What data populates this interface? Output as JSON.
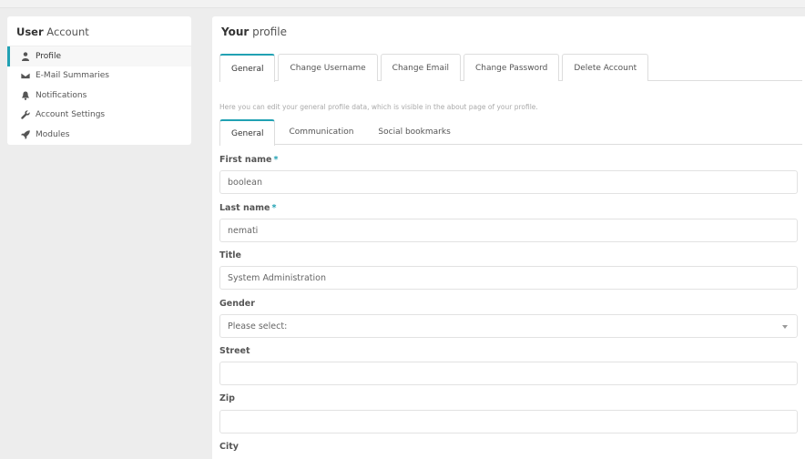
{
  "sidebar": {
    "title_bold": "User",
    "title_rest": " Account",
    "items": [
      {
        "label": "Profile",
        "icon": "user-icon",
        "active": true
      },
      {
        "label": "E-Mail Summaries",
        "icon": "envelope-icon"
      },
      {
        "label": "Notifications",
        "icon": "bell-icon"
      },
      {
        "label": "Account Settings",
        "icon": "wrench-icon"
      },
      {
        "label": "Modules",
        "icon": "rocket-icon"
      }
    ]
  },
  "main": {
    "title_bold": "Your",
    "title_rest": " profile",
    "tabs": [
      {
        "label": "General",
        "active": true
      },
      {
        "label": "Change Username"
      },
      {
        "label": "Change Email"
      },
      {
        "label": "Change Password"
      },
      {
        "label": "Delete Account"
      }
    ],
    "help_text": "Here you can edit your general profile data, which is visible in the about page of your profile.",
    "subtabs": [
      {
        "label": "General",
        "active": true
      },
      {
        "label": "Communication"
      },
      {
        "label": "Social bookmarks"
      }
    ],
    "fields": {
      "first_name": {
        "label": "First name",
        "required": "*",
        "value": "boolean"
      },
      "last_name": {
        "label": "Last name",
        "required": "*",
        "value": "nemati"
      },
      "title": {
        "label": "Title",
        "value": "System Administration"
      },
      "gender": {
        "label": "Gender",
        "value": "Please select:"
      },
      "street": {
        "label": "Street",
        "value": ""
      },
      "zip": {
        "label": "Zip",
        "value": ""
      },
      "city": {
        "label": "City"
      }
    }
  },
  "colors": {
    "accent": "#21a1b3",
    "background": "#ededed",
    "panel": "#ffffff"
  }
}
